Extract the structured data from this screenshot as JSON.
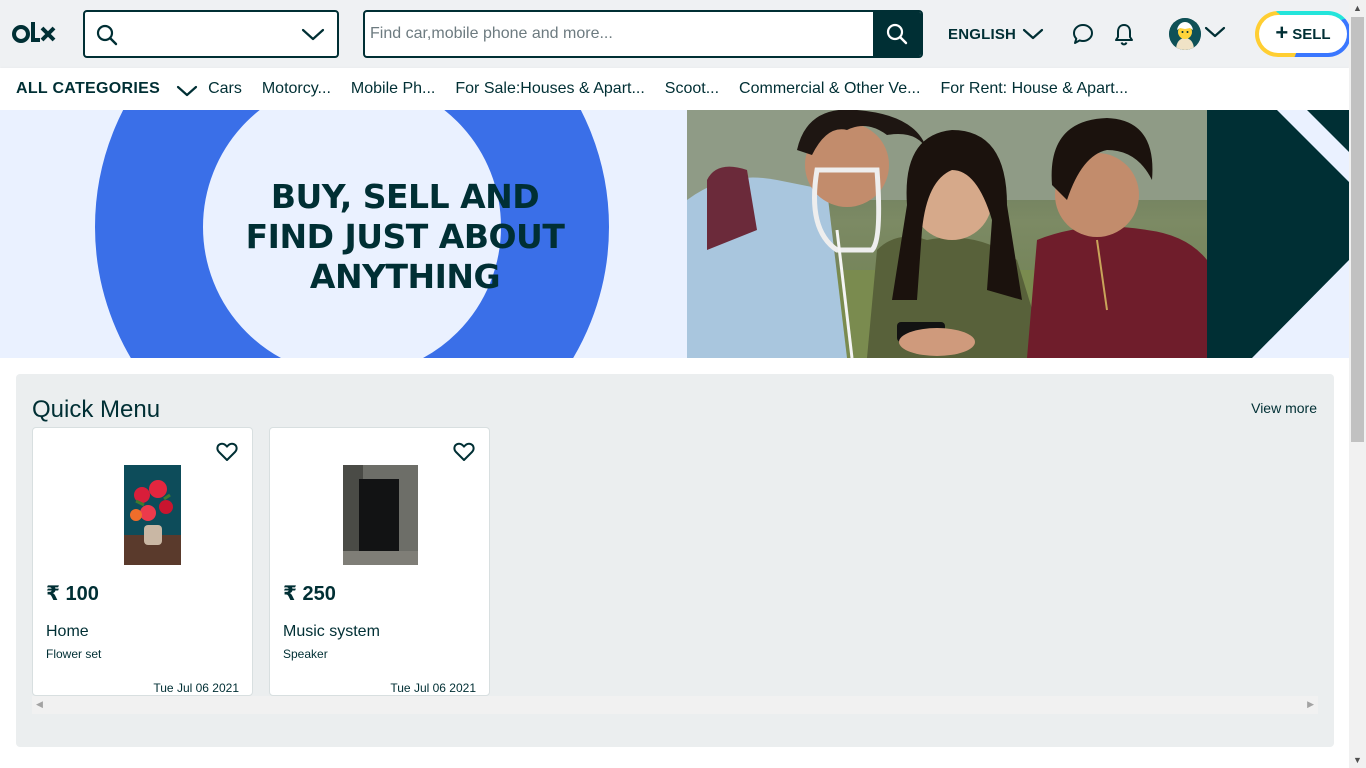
{
  "header": {
    "logo_alt": "OLX",
    "search_placeholder": "Find car,mobile phone and more...",
    "language": "ENGLISH",
    "sell_label": "SELL"
  },
  "categories": {
    "all_label": "ALL CATEGORIES",
    "items": [
      "Cars",
      "Motorcy...",
      "Mobile Ph...",
      "For Sale:Houses & Apart...",
      "Scoot...",
      "Commercial & Other Ve...",
      "For Rent: House & Apart..."
    ]
  },
  "banner": {
    "headline_line1": "BUY, SELL AND",
    "headline_line2": "FIND JUST ABOUT",
    "headline_line3": "ANYTHING"
  },
  "quick_menu": {
    "title": "Quick Menu",
    "view_more": "View more",
    "cards": [
      {
        "price": "₹ 100",
        "category": "Home",
        "title": "Flower set",
        "date": "Tue Jul 06 2021"
      },
      {
        "price": "₹ 250",
        "category": "Music system",
        "title": "Speaker",
        "date": "Tue Jul 06 2021"
      }
    ]
  },
  "colors": {
    "brand_dark": "#002f34",
    "banner_blue": "#3a6fe8",
    "banner_light": "#eaf1ff",
    "header_bg": "#eff1f3",
    "quick_bg": "#ebeeef",
    "sell_yellow": "#ffce32",
    "sell_cyan": "#23e5db",
    "sell_blue": "#3a77ff"
  },
  "icons": [
    "olx-logo",
    "search-icon",
    "chevron-down-icon",
    "chat-icon",
    "bell-icon",
    "avatar",
    "plus-icon",
    "heart-icon"
  ]
}
